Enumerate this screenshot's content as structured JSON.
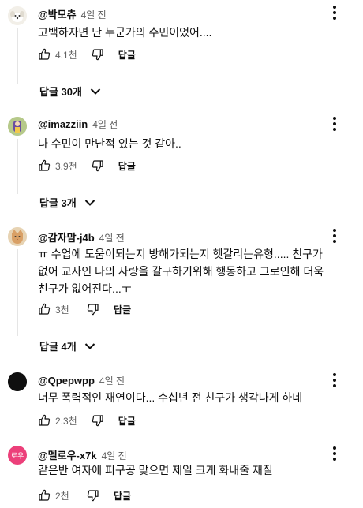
{
  "comments": [
    {
      "author": "@박모츄",
      "time": "4일 전",
      "text": "고백하자면 난 누군가의 수민이었어....",
      "likes": "4.1천",
      "reply_label": "답글",
      "replies_label": "답글 30개",
      "avatar_kind": "dog-avatar",
      "avatar_color": "#f2efe8"
    },
    {
      "author": "@imazziin",
      "time": "4일 전",
      "text": "나 수민이 만난적 있는 것 같아..",
      "likes": "3.9천",
      "reply_label": "답글",
      "replies_label": "답글 3개",
      "avatar_kind": "character-avatar",
      "avatar_color": "#b6c98a"
    },
    {
      "author": "@감자맘-j4b",
      "time": "4일 전",
      "text": "ㅠ 수업에 도움이되는지 방해가되는지 헷갈리는유형..... 친구가 없어 교사인 나의 사랑을 갈구하기위해 행동하고 그로인해 더욱 친구가 없어진다...ㅜ",
      "likes": "3천",
      "reply_label": "답글",
      "replies_label": "답글 4개",
      "avatar_kind": "cat-avatar",
      "avatar_color": "#e7d3b3"
    },
    {
      "author": "@Qpepwpp",
      "time": "4일 전",
      "text": "너무 폭력적인 재연이다... 수십년 전 친구가 생각나게 하네",
      "likes": "2.3천",
      "reply_label": "답글",
      "avatar_kind": "black-avatar",
      "avatar_color": "#0f0f0f"
    },
    {
      "author": "@멜로우-x7k",
      "time": "4일 전",
      "text": "같은반 여자애 피구공 맞으면 제일 크게 화내줄 재질",
      "likes": "2천",
      "reply_label": "답글",
      "avatar_kind": "letter-avatar",
      "avatar_letter": "로우",
      "avatar_color": "#ec407a"
    }
  ]
}
